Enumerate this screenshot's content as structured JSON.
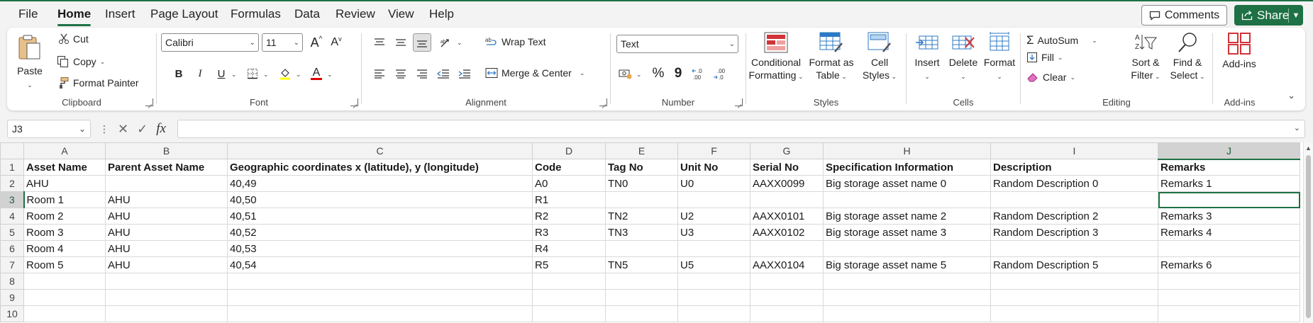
{
  "colors": {
    "accent": "#1e7145",
    "fill_yellow": "#ffff00",
    "font_red": "#e00000",
    "icon_red": "#d13438",
    "icon_blue": "#2b78c5"
  },
  "menu": {
    "tabs": [
      "File",
      "Home",
      "Insert",
      "Page Layout",
      "Formulas",
      "Data",
      "Review",
      "View",
      "Help"
    ],
    "active": "Home",
    "comments_label": "Comments",
    "share_label": "Share"
  },
  "ribbon": {
    "clipboard": {
      "label": "Clipboard",
      "paste": "Paste",
      "cut": "Cut",
      "copy": "Copy",
      "format_painter": "Format Painter"
    },
    "font": {
      "label": "Font",
      "font_name": "Calibri",
      "font_size": "11",
      "grow": "A",
      "shrink": "A",
      "bold": "B",
      "italic": "I",
      "underline": "U",
      "font_color_letter": "A"
    },
    "alignment": {
      "label": "Alignment",
      "wrap_text": "Wrap Text",
      "merge_center": "Merge & Center"
    },
    "number": {
      "label": "Number",
      "format": "Text",
      "percent": "%",
      "comma": "9"
    },
    "styles": {
      "label": "Styles",
      "conditional_formatting": [
        "Conditional",
        "Formatting"
      ],
      "format_as_table": [
        "Format as",
        "Table"
      ],
      "cell_styles": [
        "Cell",
        "Styles"
      ]
    },
    "cells": {
      "label": "Cells",
      "insert": "Insert",
      "delete": "Delete",
      "format": "Format"
    },
    "editing": {
      "label": "Editing",
      "autosum": "AutoSum",
      "fill": "Fill",
      "clear": "Clear",
      "sort_filter": [
        "Sort &",
        "Filter"
      ],
      "find_select": [
        "Find &",
        "Select"
      ]
    },
    "addins": {
      "label": "Add-ins",
      "addins": "Add-ins"
    }
  },
  "formula_bar": {
    "name_box": "J3",
    "fx": "fx",
    "formula": ""
  },
  "sheet": {
    "columns": [
      "A",
      "B",
      "C",
      "D",
      "E",
      "F",
      "G",
      "H",
      "I",
      "J"
    ],
    "selected_column": "J",
    "selected_row": 3,
    "active_cell": "J3",
    "row_numbers": [
      "1",
      "2",
      "3",
      "4",
      "5",
      "6",
      "7",
      "8",
      "9",
      "10"
    ],
    "rows": [
      [
        "Asset Name",
        "Parent Asset Name",
        "Geographic coordinates x (latitude), y (longitude)",
        "Code",
        "Tag No",
        "Unit No",
        "Serial No",
        "Specification Information",
        "Description",
        "Remarks"
      ],
      [
        "AHU",
        "",
        "40,49",
        "A0",
        "TN0",
        "U0",
        "AAXX0099",
        "Big storage asset name 0",
        "Random Description 0",
        "Remarks 1"
      ],
      [
        "Room 1",
        "AHU",
        "40,50",
        "R1",
        "",
        "",
        "",
        "",
        "",
        ""
      ],
      [
        "Room 2",
        "AHU",
        "40,51",
        "R2",
        "TN2",
        "U2",
        "AAXX0101",
        "Big storage asset name 2",
        "Random Description 2",
        "Remarks 3"
      ],
      [
        "Room 3",
        "AHU",
        "40,52",
        "R3",
        "TN3",
        "U3",
        "AAXX0102",
        "Big storage asset name 3",
        "Random Description 3",
        "Remarks 4"
      ],
      [
        "Room 4",
        "AHU",
        "40,53",
        "R4",
        "",
        "",
        "",
        "",
        "",
        ""
      ],
      [
        "Room 5",
        "AHU",
        "40,54",
        "R5",
        "TN5",
        "U5",
        "AAXX0104",
        "Big storage asset name 5",
        "Random Description 5",
        "Remarks 6"
      ],
      [
        "",
        "",
        "",
        "",
        "",
        "",
        "",
        "",
        "",
        ""
      ],
      [
        "",
        "",
        "",
        "",
        "",
        "",
        "",
        "",
        "",
        ""
      ],
      [
        "",
        "",
        "",
        "",
        "",
        "",
        "",
        "",
        "",
        ""
      ]
    ]
  }
}
